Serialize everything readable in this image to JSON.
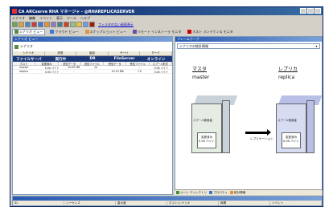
{
  "window": {
    "title": "CA ARCserve RHA マネージャ - @RHAREPLICASERVER"
  },
  "menubar": [
    "シナリオ",
    "編集",
    "イベント",
    "表示",
    "ツール",
    "ヘルプ"
  ],
  "toolbar": {
    "link": "フィルタのない画面表示"
  },
  "views": [
    {
      "label": "シナリオ ビュー",
      "active": true
    },
    {
      "label": "クラウド ビュー",
      "active": false
    },
    {
      "label": "スナップショット ビュー",
      "active": false
    },
    {
      "label": "リモート インストーラ モニタ",
      "active": false
    },
    {
      "label": "ホスト メンテナンス モニタ",
      "active": false
    }
  ],
  "left_pane": {
    "header": "シナリオ ビュー",
    "root": "シナリオ",
    "columns": [
      "シナリオ",
      "状態",
      "製品",
      "サーバ",
      "モード"
    ],
    "scenario": {
      "name": "ファイルサーバ",
      "state": "実行中",
      "product": "DR",
      "server": "FileServer",
      "mode": "オンライン"
    },
    "host_columns": [
      "ホスト",
      "変更済み",
      "送信データ",
      "送信ファイル",
      "受信データ",
      "受信ファイル",
      "スプール形式"
    ],
    "hosts": [
      {
        "name": "master",
        "changed": "0.00 バイト",
        "sent_data": "10.05 MB",
        "sent_files": "10",
        "recv_data": "-",
        "recv_files": "-",
        "spool": "0.00 バイト"
      },
      {
        "name": "replica",
        "changed": "0.00 バイト",
        "sent_data": "-",
        "sent_files": "-",
        "recv_data": "10.15 MB",
        "recv_files": "7.0",
        "spool": "0.00 バイト"
      }
    ]
  },
  "right_pane": {
    "header": "フレームワーク",
    "select_value": "シナリオの統計情報",
    "master_ja": "マスタ",
    "master_en": "master",
    "replica_ja": "レプリカ",
    "replica_en": "replica",
    "spool_label": "スプール使用量",
    "spool_value": "0.00 バイト",
    "disk_label": "変更済み",
    "disk_value": "0.00 バイト",
    "replication_label": "レプリケーション",
    "tabs": [
      "ルート ディレクトリ",
      "プロパティ",
      "統計情報"
    ],
    "colors": {
      "master": "#e4ece4",
      "replica": "#d8dcf2",
      "master_top": "#c8d2d8",
      "replica_top": "#b8c0e8"
    }
  },
  "bottom_pane": {
    "columns": [
      "ID",
      "シーケンス",
      "重大度",
      "ホスト/シナリオ",
      "時間",
      "イベント"
    ]
  }
}
